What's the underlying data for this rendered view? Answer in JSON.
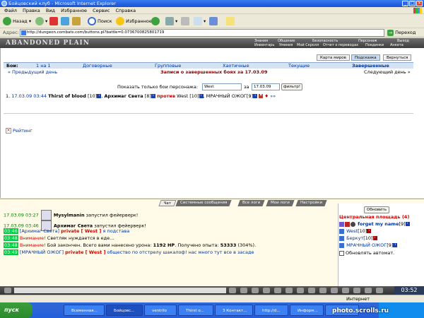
{
  "window": {
    "title": "Бойцовский клуб - Microsoft Internet Explorer"
  },
  "menu": [
    "Файл",
    "Правка",
    "Вид",
    "Избранное",
    "Сервис",
    "Справка"
  ],
  "toolbar": {
    "back": "Назад",
    "search": "Поиск",
    "favorites": "Избранное"
  },
  "address": {
    "label": "Адрес:",
    "url": "http://dungeon.combats.com/buttons.pl?battle=0.0736700825801719",
    "go": "Переход"
  },
  "game": {
    "logo": "ABANDONED PLAIN",
    "nav_top": [
      "Знания",
      "Общение",
      "Безопасность",
      "Персонаж",
      "Выход"
    ],
    "nav_bottom": [
      "Инвентарь",
      "Умения",
      "Мой Скролл",
      "Отчет о переводах",
      "Поединки",
      "Анкета"
    ]
  },
  "subnav": [
    "Карта миров",
    "Подсказка",
    "Вернуться"
  ],
  "battle_tabs": [
    "Бои:",
    "1 на 1",
    "Договорные",
    "Групповые",
    "Хаотичные",
    "Текущие",
    "Завершенные"
  ],
  "nav": {
    "prev": "« Предыдущий день",
    "title": "Записи о завершенных боях за 17.03.09",
    "next": "Следующий день »"
  },
  "filter": {
    "label": "Показать только бои персонажа:",
    "name_value": "West",
    "date_label": "за",
    "date_value": "17.03.09",
    "button": "фильтр!"
  },
  "battle": {
    "index": "1.",
    "time": "17.03.09 03:44",
    "team1": "Thirst of blood",
    "team1_level": "[10]",
    "team2_member": "Архимаг Света",
    "team2_level": "[8]",
    "vs": "против",
    "enemy1": "West",
    "enemy1_level": "[10]",
    "enemy2": "МРАЧНЫЙ ОЖОГ",
    "enemy2_level": "[9]",
    "more": "»»"
  },
  "rating": "Рейтинг",
  "chat_tabs": [
    "Чат",
    "Системные сообщения",
    "Все логи",
    "Мои логи",
    "Настройки"
  ],
  "chat": {
    "l1_time": "17.03.09 03:27",
    "l1_name": "Mysylmanin",
    "l1_text": "запустил фейерверк!",
    "l2_time": "17.03.09 03:46",
    "l2_name": "Архимаг Света",
    "l2_text": "запустил фейерверк!",
    "l3_time": "03:46",
    "l3_name": "[Архимаг Света]",
    "l3_private": "private [ West ]",
    "l3_text": "я подстава",
    "l4_time": "03:48",
    "l4_warn": "Внимание!",
    "l4_text": "Светляк нуждается в еде...",
    "l5_time": "03:48",
    "l5_warn": "Внимание!",
    "l5_text_a": "Бой закончен. Всего вами нанесено урона:",
    "l5_damage": "1192 HP",
    "l5_text_b": ". Получено опыта:",
    "l5_exp": "53333",
    "l5_pct": "(304%).",
    "l6_time": "03:49",
    "l6_name": "[МРАЧНЫЙ ОЖОГ]",
    "l6_private": "private [ West ]",
    "l6_text": "общество по отстрелу шакалоф! нас много тут все в засаде"
  },
  "location": {
    "refresh": "Обновить",
    "title": "Центральная площадь (4)",
    "players": [
      {
        "name": "forget my name",
        "level": "[9]"
      },
      {
        "name": "West",
        "level": "[10]"
      },
      {
        "name": "Беркут",
        "level": "[10]"
      },
      {
        "name": "МРАЧНЫЙ ОЖОГ",
        "level": "[9]"
      }
    ],
    "auto": "Обновлять автомат."
  },
  "clock": "03:52",
  "status": {
    "zone": "Интернет"
  },
  "taskbar": {
    "start": "пуск",
    "tasks": [
      "Всеменная...",
      "Бойцовс...",
      "ventrilo",
      "Thirst o...",
      "3 Контакт...",
      "http://d...",
      "Информ...",
      "Информ..."
    ]
  },
  "watermark": "photo.scrolls.ru"
}
